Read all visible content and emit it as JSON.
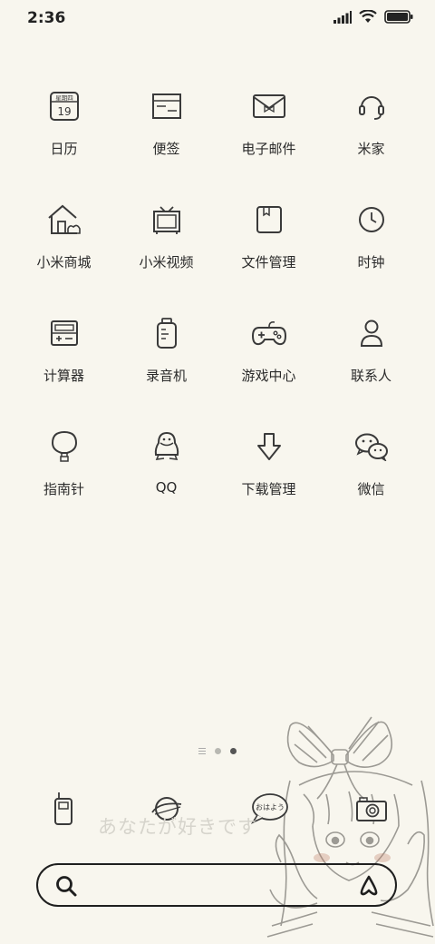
{
  "status": {
    "time": "2:36"
  },
  "apps": [
    [
      {
        "name": "calendar",
        "label": "日历",
        "icon": "calendar-icon",
        "icon_text_top": "星期四",
        "icon_text_num": "19"
      },
      {
        "name": "notes",
        "label": "便签",
        "icon": "notes-icon"
      },
      {
        "name": "email",
        "label": "电子邮件",
        "icon": "envelope-icon"
      },
      {
        "name": "mijia",
        "label": "米家",
        "icon": "headset-icon"
      }
    ],
    [
      {
        "name": "mi-store",
        "label": "小米商城",
        "icon": "house-icon"
      },
      {
        "name": "mi-video",
        "label": "小米视频",
        "icon": "tv-icon"
      },
      {
        "name": "file-manager",
        "label": "文件管理",
        "icon": "book-icon"
      },
      {
        "name": "clock",
        "label": "时钟",
        "icon": "clock-icon"
      }
    ],
    [
      {
        "name": "calculator",
        "label": "计算器",
        "icon": "calculator-icon"
      },
      {
        "name": "recorder",
        "label": "录音机",
        "icon": "recorder-icon"
      },
      {
        "name": "game-center",
        "label": "游戏中心",
        "icon": "gamepad-icon"
      },
      {
        "name": "contacts",
        "label": "联系人",
        "icon": "person-icon"
      }
    ],
    [
      {
        "name": "compass",
        "label": "指南针",
        "icon": "balloon-icon"
      },
      {
        "name": "qq",
        "label": "QQ",
        "icon": "penguin-icon"
      },
      {
        "name": "downloads",
        "label": "下载管理",
        "icon": "download-arrow-icon"
      },
      {
        "name": "wechat",
        "label": "微信",
        "icon": "wechat-icon"
      }
    ]
  ],
  "dock": [
    {
      "name": "phone",
      "icon": "walkie-talkie-icon"
    },
    {
      "name": "browser",
      "icon": "planet-icon"
    },
    {
      "name": "messages",
      "icon": "speech-bubble-icon",
      "bubble_text": "おはよう"
    },
    {
      "name": "camera",
      "icon": "camera-icon"
    }
  ],
  "wallpaper_text": "あなたが好きです",
  "page_indicator": {
    "pages": 3,
    "active": 2
  },
  "colors": {
    "background": "#f8f6ee",
    "icon_stroke": "#3a3a3a",
    "label": "#2b2b2b"
  }
}
